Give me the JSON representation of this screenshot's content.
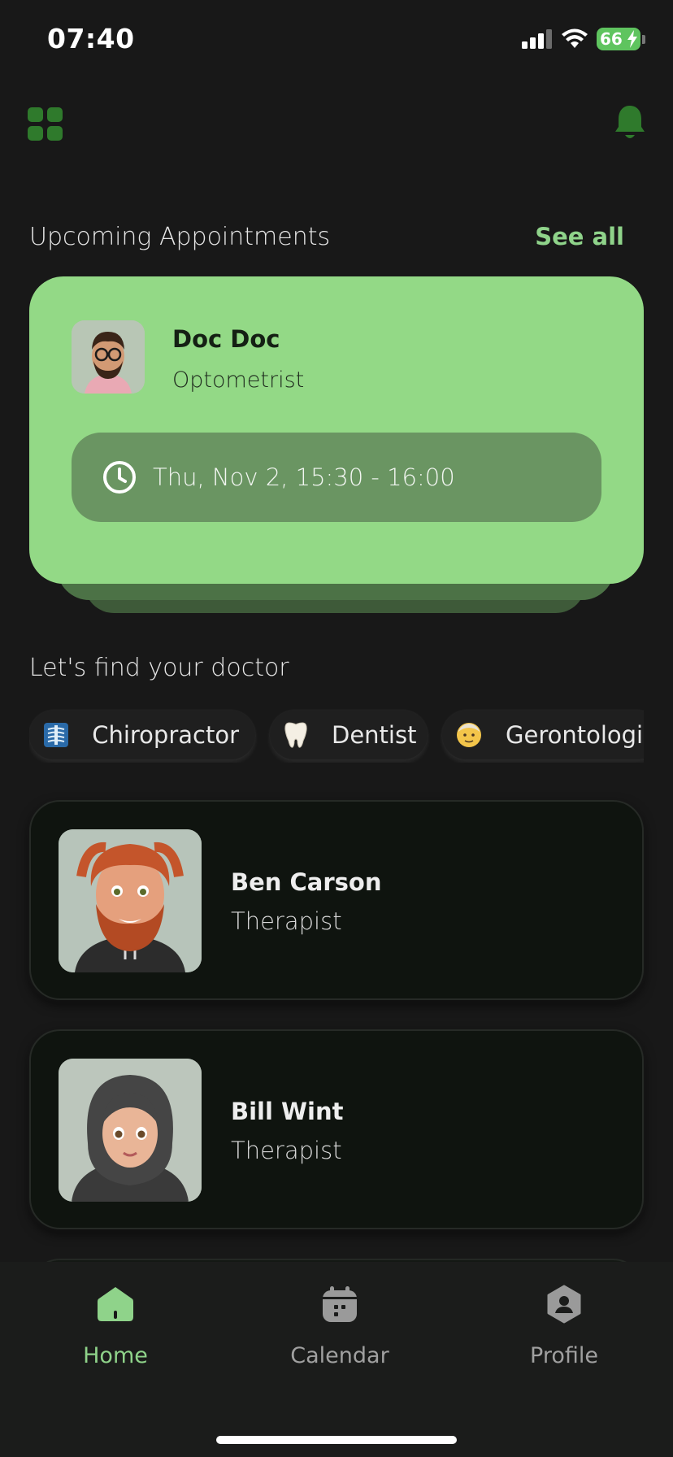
{
  "status_bar": {
    "time": "07:40",
    "battery": "66"
  },
  "colors": {
    "accent": "#8fd38a",
    "card_green": "#93d986",
    "background": "#181818"
  },
  "header": {
    "menu_icon": "grid-icon",
    "notification_icon": "bell-icon"
  },
  "appointments": {
    "title": "Upcoming Appointments",
    "see_all": "See all",
    "card": {
      "doctor_name": "Doc Doc",
      "specialty": "Optometrist",
      "time": "Thu, Nov 2, 15:30 - 16:00"
    }
  },
  "find_doctor": {
    "title": "Let's find your doctor",
    "categories": [
      {
        "label": "Chiropractor",
        "icon": "xray-icon"
      },
      {
        "label": "Dentist",
        "icon": "tooth-icon"
      },
      {
        "label": "Gerontologi",
        "icon": "older-person-icon"
      }
    ]
  },
  "doctors": [
    {
      "name": "Ben Carson",
      "role": "Therapist"
    },
    {
      "name": "Bill Wint",
      "role": "Therapist"
    }
  ],
  "nav": {
    "home": "Home",
    "calendar": "Calendar",
    "profile": "Profile"
  }
}
